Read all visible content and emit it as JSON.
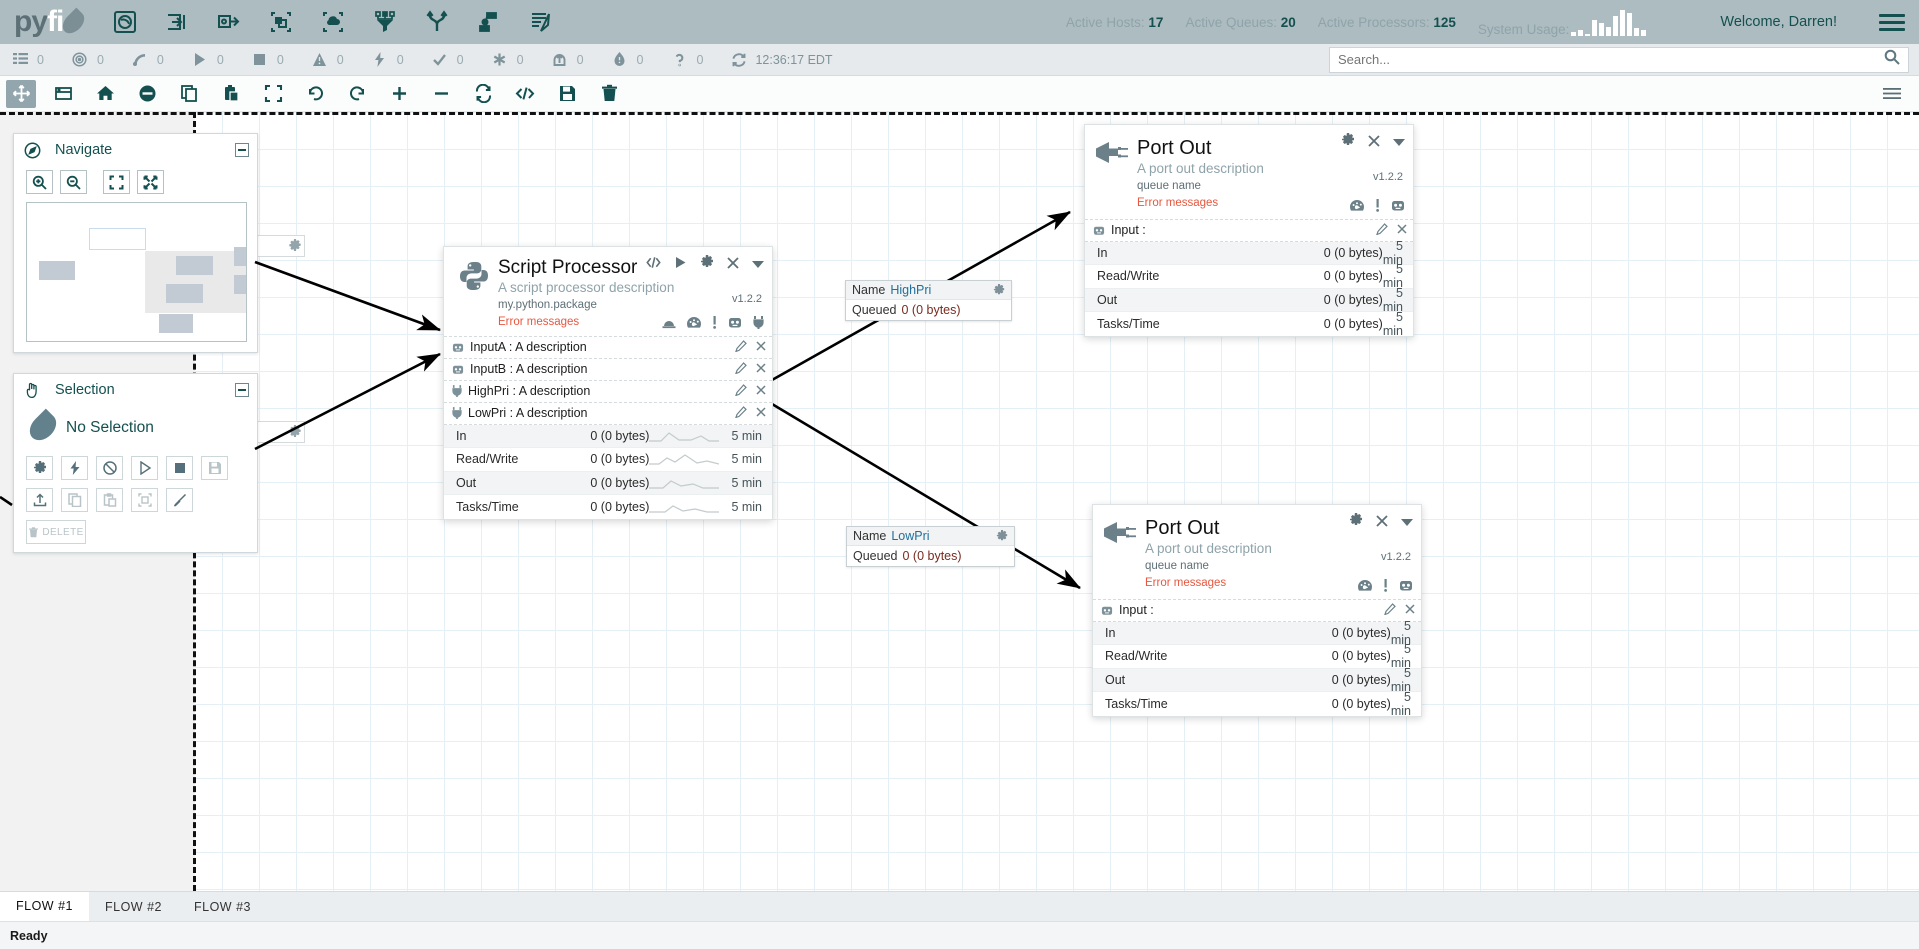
{
  "app": {
    "logo_text_1": "py",
    "logo_text_2": "fi",
    "welcome": "Welcome, Darren!"
  },
  "topbar": {
    "icons": [
      {
        "name": "processor-icon",
        "label": "Processor"
      },
      {
        "name": "input-port-icon",
        "label": "Input Port"
      },
      {
        "name": "output-port-icon",
        "label": "Output Port"
      },
      {
        "name": "process-group-icon",
        "label": "Process Group"
      },
      {
        "name": "remote-process-group-icon",
        "label": "Remote Process Group"
      },
      {
        "name": "funnel-icon",
        "label": "Funnel"
      },
      {
        "name": "template-icon",
        "label": "Template"
      },
      {
        "name": "label-icon",
        "label": "Label"
      },
      {
        "name": "notes-icon",
        "label": "Notes"
      }
    ],
    "stats": [
      {
        "label": "Active Hosts:",
        "value": "17"
      },
      {
        "label": "Active Queues:",
        "value": "20"
      },
      {
        "label": "Active Processors:",
        "value": "125"
      }
    ],
    "usage_label": "System Usage:",
    "usage_bars": [
      4,
      6,
      2,
      16,
      13,
      9,
      20,
      26,
      23,
      8,
      6
    ]
  },
  "counterbar": {
    "counters": [
      {
        "icon": "list-icon",
        "value": "0"
      },
      {
        "icon": "target-icon",
        "value": "0"
      },
      {
        "icon": "transmit-icon",
        "value": "0"
      },
      {
        "icon": "play-icon",
        "value": "0"
      },
      {
        "icon": "stop-icon",
        "value": "0"
      },
      {
        "icon": "warning-icon",
        "value": "0"
      },
      {
        "icon": "bolt-icon",
        "value": "0"
      },
      {
        "icon": "check-icon",
        "value": "0"
      },
      {
        "icon": "asterisk-icon",
        "value": "0"
      },
      {
        "icon": "upload-icon",
        "value": "0"
      },
      {
        "icon": "info-icon",
        "value": "0"
      },
      {
        "icon": "question-icon",
        "value": "0"
      }
    ],
    "refresh_icon": "refresh-icon",
    "clock": "12:36:17 EDT",
    "search_placeholder": "Search...",
    "search_value": ""
  },
  "graphbar": {
    "tools": [
      {
        "name": "pan-tool",
        "active": true
      },
      {
        "name": "select-box-tool",
        "active": false
      },
      {
        "name": "home-tool",
        "active": false
      },
      {
        "name": "disable-tool",
        "active": false
      },
      {
        "name": "copy-tool",
        "active": false
      },
      {
        "name": "paste-tool",
        "active": false
      },
      {
        "name": "fit-tool",
        "active": false
      },
      {
        "name": "undo-tool",
        "active": false
      },
      {
        "name": "redo-tool",
        "active": false
      },
      {
        "name": "zoom-in-tool",
        "active": false
      },
      {
        "name": "zoom-out-tool",
        "active": false
      },
      {
        "name": "refresh-tool",
        "active": false
      },
      {
        "name": "code-tool",
        "active": false
      },
      {
        "name": "save-tool",
        "active": false
      },
      {
        "name": "delete-tool",
        "active": false
      }
    ],
    "menu_icon": "list-menu-icon"
  },
  "navigate_panel": {
    "title": "Navigate",
    "icon": "compass-icon",
    "minimize": "minimize-icon",
    "buttons": [
      {
        "name": "zoom-in-button",
        "icon": "zoom-in-icon"
      },
      {
        "name": "zoom-out-button",
        "icon": "zoom-out-icon"
      },
      {
        "name": "fit-to-screen-button",
        "icon": "fit-screen-icon"
      },
      {
        "name": "actual-size-button",
        "icon": "expand-icon"
      }
    ]
  },
  "selection_panel": {
    "title": "Selection",
    "icon": "hand-pointer-icon",
    "minimize": "minimize-icon",
    "status": "No Selection",
    "tools": [
      {
        "name": "configure-button",
        "icon": "gear-icon",
        "label": ""
      },
      {
        "name": "enable-button",
        "icon": "bolt-icon",
        "label": ""
      },
      {
        "name": "disable-button",
        "icon": "disable-icon",
        "label": ""
      },
      {
        "name": "start-button",
        "icon": "play-icon",
        "label": ""
      },
      {
        "name": "stop-button",
        "icon": "stop-icon",
        "label": ""
      },
      {
        "name": "save-button",
        "icon": "save-icon",
        "label": ""
      },
      {
        "name": "upload-button",
        "icon": "upload-icon",
        "label": ""
      },
      {
        "name": "copy-button",
        "icon": "copy-icon",
        "label": ""
      },
      {
        "name": "paste-button",
        "icon": "paste-icon",
        "label": ""
      },
      {
        "name": "group-button",
        "icon": "group-icon",
        "label": ""
      },
      {
        "name": "color-button",
        "icon": "brush-icon",
        "label": ""
      },
      {
        "name": "delete-button",
        "icon": "trash-icon",
        "label": "DELETE"
      }
    ]
  },
  "nodes": {
    "script_processor": {
      "title": "Script Processor",
      "subtitle": "A script processor description",
      "package": "my.python.package",
      "error": "Error messages",
      "version": "v1.2.2",
      "logo_icon": "python-icon",
      "head_icons": [
        "code-icon",
        "play-icon",
        "gear-icon",
        "close-icon",
        "chevron-down-icon"
      ],
      "status_icons": [
        "hardhat-icon",
        "gauge-icon",
        "exclamation-icon",
        "bug-icon",
        "plug-icon"
      ],
      "ports": [
        {
          "icon": "bug-port-icon",
          "label": "InputA : A description"
        },
        {
          "icon": "bug-port-icon",
          "label": "InputB : A description"
        },
        {
          "icon": "plug-port-icon",
          "label": "HighPri : A description"
        },
        {
          "icon": "plug-port-icon",
          "label": "LowPri : A description"
        }
      ],
      "metrics": [
        {
          "label": "In",
          "value": "0 (0 bytes)",
          "time": "5 min"
        },
        {
          "label": "Read/Write",
          "value": "0 (0 bytes)",
          "time": "5 min"
        },
        {
          "label": "Out",
          "value": "0 (0 bytes)",
          "time": "5 min"
        },
        {
          "label": "Tasks/Time",
          "value": "0 (0 bytes)",
          "time": "5 min"
        }
      ]
    },
    "port_out_1": {
      "title": "Port Out",
      "subtitle": "A port out description",
      "package": "queue name",
      "error": "Error messages",
      "version": "v1.2.2",
      "logo_icon": "plug-icon",
      "head_icons": [
        "gear-icon",
        "close-icon",
        "chevron-down-icon"
      ],
      "status_icons": [
        "gauge-icon",
        "exclamation-icon",
        "bug-icon"
      ],
      "ports": [
        {
          "icon": "bug-port-icon",
          "label": "Input :"
        }
      ],
      "metrics": [
        {
          "label": "In",
          "value": "0 (0 bytes)",
          "time": "5 min"
        },
        {
          "label": "Read/Write",
          "value": "0 (0 bytes)",
          "time": "5 min"
        },
        {
          "label": "Out",
          "value": "0 (0 bytes)",
          "time": "5 min"
        },
        {
          "label": "Tasks/Time",
          "value": "0 (0 bytes)",
          "time": "5 min"
        }
      ]
    },
    "port_out_2": {
      "title": "Port Out",
      "subtitle": "A port out description",
      "package": "queue name",
      "error": "Error messages",
      "version": "v1.2.2",
      "logo_icon": "plug-icon",
      "head_icons": [
        "gear-icon",
        "close-icon",
        "chevron-down-icon"
      ],
      "status_icons": [
        "gauge-icon",
        "exclamation-icon",
        "bug-icon"
      ],
      "ports": [
        {
          "icon": "bug-port-icon",
          "label": "Input :"
        }
      ],
      "metrics": [
        {
          "label": "In",
          "value": "0 (0 bytes)",
          "time": "5 min"
        },
        {
          "label": "Read/Write",
          "value": "0 (0 bytes)",
          "time": "5 min"
        },
        {
          "label": "Out",
          "value": "0 (0 bytes)",
          "time": "5 min"
        },
        {
          "label": "Tasks/Time",
          "value": "0 (0 bytes)",
          "time": "5 min"
        }
      ]
    }
  },
  "queues": [
    {
      "name_label": "Name",
      "name_value": "HighPri",
      "queued_label": "Queued",
      "queued_value": "0 (0 bytes)",
      "gear": "gear-icon"
    },
    {
      "name_label": "Name",
      "name_value": "LowPri",
      "queued_label": "Queued",
      "queued_value": "0 (0 bytes)",
      "gear": "gear-icon"
    }
  ],
  "footer": {
    "tabs": [
      {
        "label": "FLOW #1",
        "active": true
      },
      {
        "label": "FLOW #2",
        "active": false
      },
      {
        "label": "FLOW #3",
        "active": false
      }
    ],
    "status": "Ready"
  },
  "colors": {
    "topbar_bg": "#adbcc0",
    "accent_dark": "#14504f",
    "error": "#e8573f",
    "queue_name": "#1f6f9c",
    "queue_value": "#7a2b1f"
  }
}
